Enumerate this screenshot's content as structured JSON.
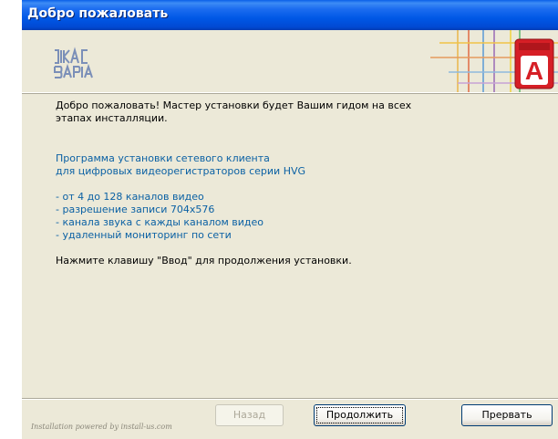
{
  "window": {
    "title": "Добро пожаловать"
  },
  "header": {
    "logo_name": "rikas-varia-logo",
    "badge_name": "red-a-badge-icon",
    "badge_letter": "A"
  },
  "content": {
    "intro_line1": "Добро пожаловать! Мастер установки будет Вашим гидом на всех",
    "intro_line2": "этапах инсталляции.",
    "program_line1": "Программа установки сетевого клиента",
    "program_line2": "для цифровых видеорегистраторов серии HVG",
    "features": [
      "- от 4 до 128 каналов видео",
      "- разрешение записи 704x576",
      "- канала звука с кажды каналом видео",
      "- удаленный мониторинг по сети"
    ],
    "instruction": "Нажмите клавишу \"Ввод\" для продолжения установки."
  },
  "footer": {
    "powered_by": "Installation powered by install-us.com"
  },
  "buttons": {
    "back": "Назад",
    "next": "Продолжить",
    "cancel": "Прервать"
  },
  "colors": {
    "title_bar": "#0058E6",
    "window_bg": "#ECE9D8",
    "blue_text": "#0B61A4",
    "badge_red": "#D61F26"
  }
}
